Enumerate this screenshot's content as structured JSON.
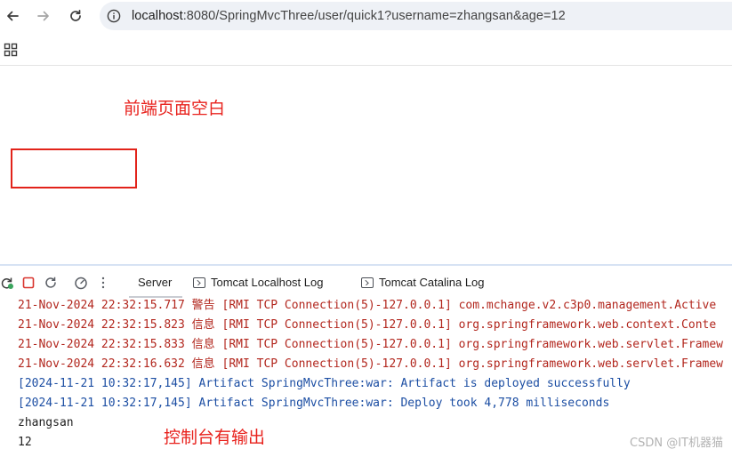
{
  "browser": {
    "url_host": "localhost",
    "url_rest": ":8080/SpringMvcThree/user/quick1?username=zhangsan&age=12"
  },
  "annotations": {
    "page_blank": "前端页面空白",
    "console_output": "控制台有输出"
  },
  "ide": {
    "tabs": [
      {
        "label": "Server"
      },
      {
        "label": "Tomcat Localhost Log"
      },
      {
        "label": "Tomcat Catalina Log"
      }
    ],
    "log_lines": [
      {
        "text": "21-Nov-2024 22:32:15.717 警告 [RMI TCP Connection(5)-127.0.0.1] com.mchange.v2.c3p0.management.Active"
      },
      {
        "text": "21-Nov-2024 22:32:15.823 信息 [RMI TCP Connection(5)-127.0.0.1] org.springframework.web.context.Conte"
      },
      {
        "text": "21-Nov-2024 22:32:15.833 信息 [RMI TCP Connection(5)-127.0.0.1] org.springframework.web.servlet.Framew"
      },
      {
        "text": "21-Nov-2024 22:32:16.632 信息 [RMI TCP Connection(5)-127.0.0.1] org.springframework.web.servlet.Framew"
      },
      {
        "text": "[2024-11-21 10:32:17,145] Artifact SpringMvcThree:war: Artifact is deployed successfully"
      },
      {
        "text": "[2024-11-21 10:32:17,145] Artifact SpringMvcThree:war: Deploy took 4,778 milliseconds"
      },
      {
        "text": "zhangsan"
      },
      {
        "text": "12"
      }
    ]
  },
  "watermark": "CSDN @IT机器猫",
  "colors": {
    "log_warning_red": "#b2261d",
    "log_info_blue": "#1c4ea3",
    "annotation_red": "#e8211c"
  }
}
